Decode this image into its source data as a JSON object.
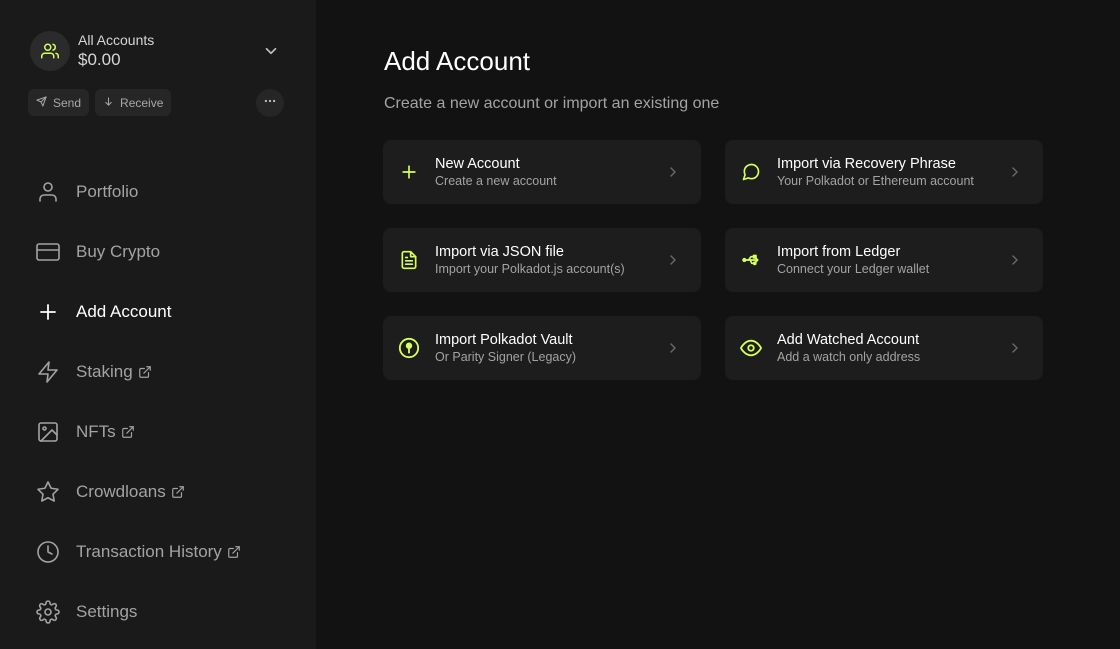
{
  "account": {
    "name": "All Accounts",
    "total": "$0.00"
  },
  "quick_actions": {
    "send_label": "Send",
    "receive_label": "Receive"
  },
  "nav": {
    "items": [
      {
        "label": "Portfolio",
        "icon": "user-icon",
        "active": false,
        "external": false
      },
      {
        "label": "Buy Crypto",
        "icon": "credit-card-icon",
        "active": false,
        "external": false
      },
      {
        "label": "Add Account",
        "icon": "plus-icon",
        "active": true,
        "external": false
      },
      {
        "label": "Staking",
        "icon": "zap-icon",
        "active": false,
        "external": true
      },
      {
        "label": "NFTs",
        "icon": "image-icon",
        "active": false,
        "external": true
      },
      {
        "label": "Crowdloans",
        "icon": "star-icon",
        "active": false,
        "external": true
      },
      {
        "label": "Transaction History",
        "icon": "clock-icon",
        "active": false,
        "external": true
      },
      {
        "label": "Settings",
        "icon": "gear-icon",
        "active": false,
        "external": false
      }
    ]
  },
  "main": {
    "title": "Add Account",
    "subtitle": "Create a new account or import an existing one",
    "cards": [
      {
        "title": "New Account",
        "desc": "Create a new account",
        "icon": "plus-icon"
      },
      {
        "title": "Import via Recovery Phrase",
        "desc": "Your Polkadot or Ethereum account",
        "icon": "message-circle-icon"
      },
      {
        "title": "Import via JSON file",
        "desc": "Import your Polkadot.js account(s)",
        "icon": "file-text-icon"
      },
      {
        "title": "Import from Ledger",
        "desc": "Connect your Ledger wallet",
        "icon": "usb-icon"
      },
      {
        "title": "Import Polkadot Vault",
        "desc": "Or Parity Signer (Legacy)",
        "icon": "vault-icon"
      },
      {
        "title": "Add Watched Account",
        "desc": "Add a watch only address",
        "icon": "eye-icon"
      }
    ]
  },
  "colors": {
    "accent": "#d5ff5c",
    "background": "#121212",
    "sidebar": "#1a1a1a",
    "card": "#1d1d1d",
    "muted_text": "#a3a3a3"
  }
}
